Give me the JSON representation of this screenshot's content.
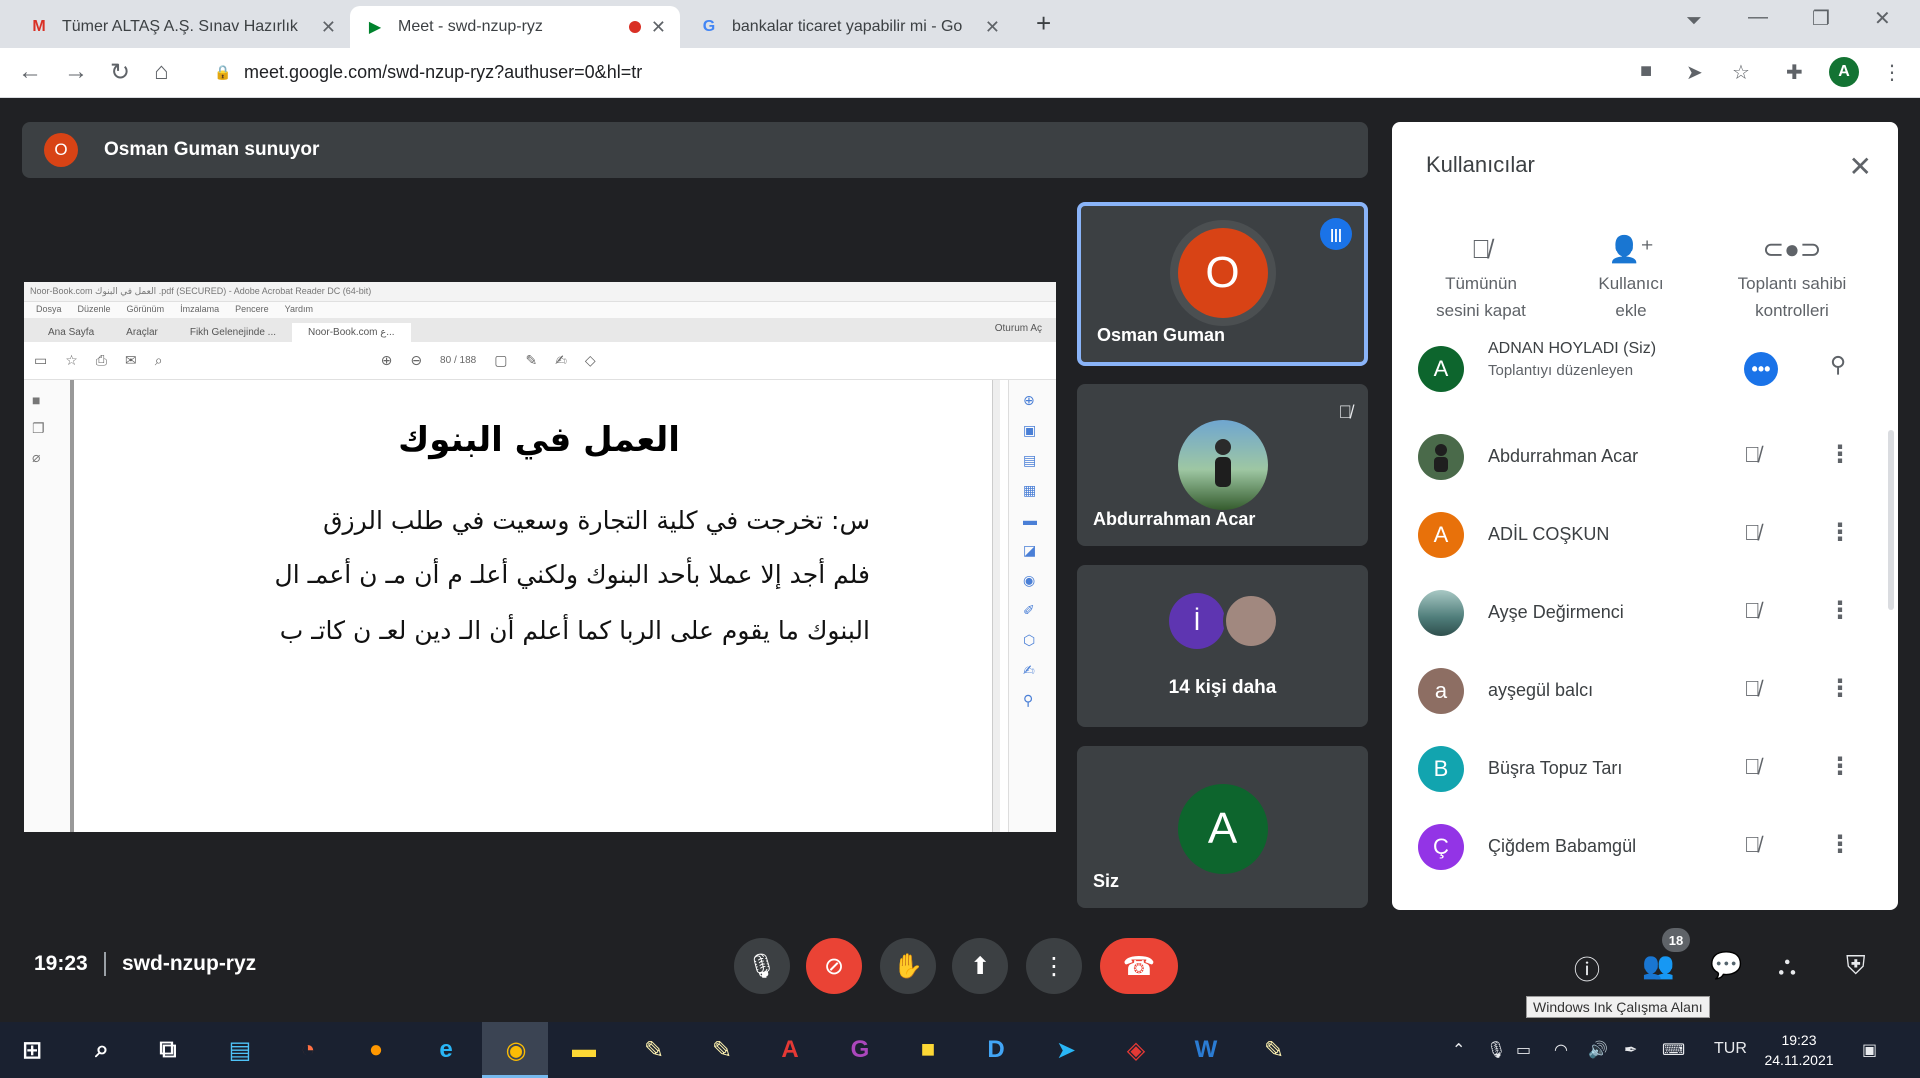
{
  "browser": {
    "tabs": [
      {
        "title": "Tümer ALTAŞ A.Ş. Sınav Hazırlık",
        "favicon": "gmail-icon",
        "active": false
      },
      {
        "title": "Meet - swd-nzup-ryz",
        "favicon": "meet-icon",
        "active": true,
        "recording": true
      },
      {
        "title": "bankalar ticaret yapabilir mi - Go",
        "favicon": "google-icon",
        "active": false
      }
    ],
    "url": "meet.google.com/swd-nzup-ryz?authuser=0&hl=tr",
    "profile_initial": "A"
  },
  "meet": {
    "presenter_initial": "O",
    "presenter_text": "Osman Guman sunuyor",
    "shared_doc": {
      "window_title": "Noor-Book.com  العمل في البنوك  .pdf (SECURED) - Adobe Acrobat Reader DC (64-bit)",
      "menu": [
        "Dosya",
        "Düzenle",
        "Görünüm",
        "İmzalama",
        "Pencere",
        "Yardım"
      ],
      "tabs": [
        "Ana Sayfa",
        "Araçlar",
        "Fikh Gelenejinde ...",
        "Noor-Book.com  ع..."
      ],
      "sign_in": "Oturum Aç",
      "page_indicator": "80 / 188",
      "title": "العمل في البنوك",
      "lines": [
        "س: تخرجت في كلية التجارة وسعيت في طلب الرزق",
        "فلم أجد إلا عملا بأحد البنوك ولكني أعلـ م أن مـ ن أعمـ ال",
        "البنوك ما يقوم على الربا كما أعلم أن الـ دين لعـ ن كاتـ ب"
      ]
    },
    "tiles": [
      {
        "name": "Osman Guman",
        "initial": "O",
        "color": "#d84315"
      },
      {
        "name": "Abdurrahman Acar"
      },
      {
        "name": "14 kişi daha",
        "initial": "İ"
      },
      {
        "name": "Siz",
        "initial": "A",
        "color": "#0d652d"
      }
    ],
    "time": "19:23",
    "code": "swd-nzup-ryz",
    "participant_count": "18",
    "tooltip": "Windows Ink Çalışma Alanı"
  },
  "panel": {
    "title": "Kullanıcılar",
    "actions": [
      {
        "line1": "Tümünün",
        "line2": "sesini kapat",
        "icon": "mic-off-icon"
      },
      {
        "line1": "Kullanıcı",
        "line2": "ekle",
        "icon": "add-person-icon"
      },
      {
        "line1": "Toplantı sahibi",
        "line2": "kontrolleri",
        "icon": "toggle-icon"
      }
    ],
    "participants": [
      {
        "name": "ADNAN HOYLADI (Siz)",
        "sub": "Toplantıyı düzenleyen",
        "initial": "A",
        "color": "#0d652d"
      },
      {
        "name": "Abdurrahman Acar",
        "initial": "",
        "color": "#4a6a4a"
      },
      {
        "name": "ADİL COŞKUN",
        "initial": "A",
        "color": "#e8710a"
      },
      {
        "name": "Ayşe Değirmenci",
        "initial": "",
        "color": "#4f7d7a"
      },
      {
        "name": "ayşegül balcı",
        "initial": "a",
        "color": "#8d6e63"
      },
      {
        "name": "Büşra Topuz Tarı",
        "initial": "B",
        "color": "#12a4af"
      },
      {
        "name": "Çiğdem Babamgül",
        "initial": "Ç",
        "color": "#9334e6"
      }
    ]
  },
  "taskbar": {
    "lang": "TUR",
    "time": "19:23",
    "date": "24.11.2021"
  }
}
